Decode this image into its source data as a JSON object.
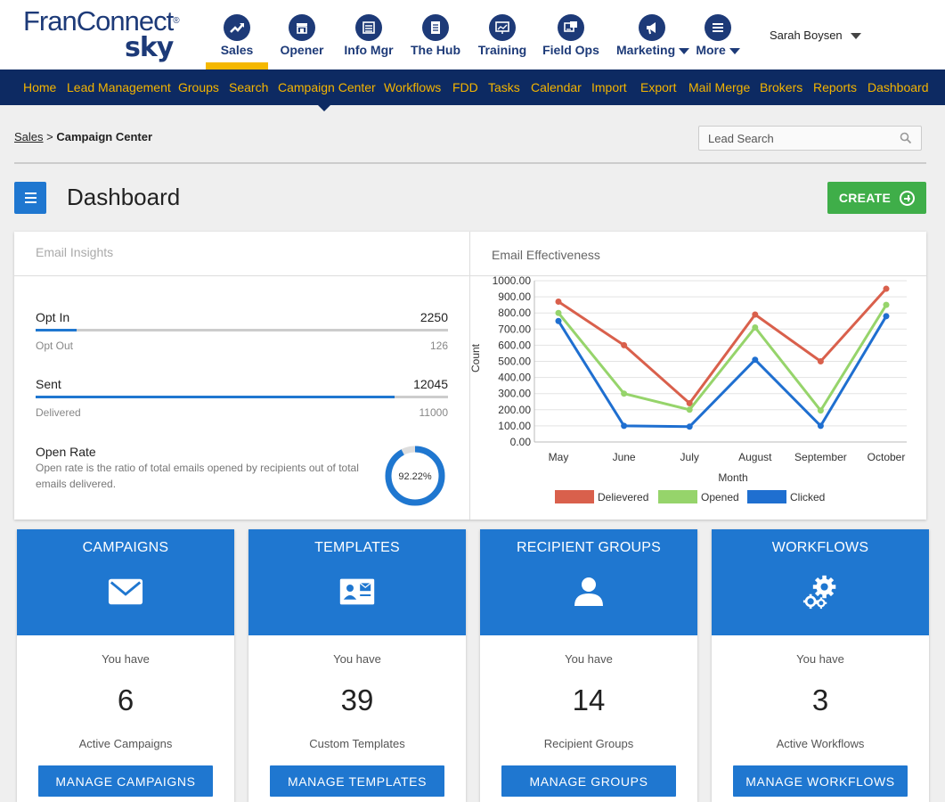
{
  "header": {
    "logo_text_main": "FranConnect",
    "logo_reg": "®",
    "logo_text_sub": "sky",
    "modules": [
      {
        "label": "Sales",
        "icon": "trending-up-icon"
      },
      {
        "label": "Opener",
        "icon": "storefront-icon"
      },
      {
        "label": "Info Mgr",
        "icon": "list-icon"
      },
      {
        "label": "The Hub",
        "icon": "document-icon"
      },
      {
        "label": "Training",
        "icon": "presentation-icon"
      },
      {
        "label": "Field Ops",
        "icon": "tasks-icon"
      },
      {
        "label": "Marketing",
        "icon": "megaphone-icon"
      },
      {
        "label": "More",
        "icon": "hamburger-icon"
      }
    ],
    "user_name": "Sarah Boysen"
  },
  "nav": {
    "items": [
      "Home",
      "Lead Management",
      "Groups",
      "Search",
      "Campaign Center",
      "Workflows",
      "FDD",
      "Tasks",
      "Calendar",
      "Import",
      "Export",
      "Mail Merge",
      "Brokers",
      "Reports",
      "Dashboard"
    ]
  },
  "breadcrumb": {
    "root": "Sales",
    "separator": ">",
    "current": "Campaign Center"
  },
  "search": {
    "placeholder": "Lead Search"
  },
  "page": {
    "title": "Dashboard",
    "create_label": "CREATE"
  },
  "insights": {
    "title": "Email Insights",
    "opt_in_label": "Opt In",
    "opt_in_value": "2250",
    "opt_out_label": "Opt Out",
    "opt_out_value": "126",
    "opt_in_fill": 0.1,
    "sent_label": "Sent",
    "sent_value": "12045",
    "delivered_label": "Delivered",
    "delivered_value": "11000",
    "sent_fill": 0.87,
    "open_rate_title": "Open Rate",
    "open_rate_desc": "Open rate is the ratio of total emails opened by recipients out of total emails delivered.",
    "open_rate_value": "92.22%",
    "open_rate_fraction": 0.9222
  },
  "chart_data": {
    "type": "line",
    "title": "Email Effectiveness",
    "xlabel": "Month",
    "ylabel": "Count",
    "categories": [
      "May",
      "June",
      "July",
      "August",
      "September",
      "October"
    ],
    "ylim": [
      0,
      1000
    ],
    "yticks": [
      "0.00",
      "100.00",
      "200.00",
      "300.00",
      "400.00",
      "500.00",
      "600.00",
      "700.00",
      "800.00",
      "900.00",
      "1000.00"
    ],
    "grid": true,
    "legend_position": "bottom",
    "series": [
      {
        "name": "Delievered",
        "color": "#d9604c",
        "values": [
          870,
          600,
          240,
          790,
          500,
          950
        ]
      },
      {
        "name": "Opened",
        "color": "#96d46b",
        "values": [
          800,
          300,
          200,
          710,
          195,
          850
        ]
      },
      {
        "name": "Clicked",
        "color": "#1f6fd0",
        "values": [
          750,
          100,
          95,
          510,
          100,
          780
        ]
      }
    ]
  },
  "cards": [
    {
      "title": "CAMPAIGNS",
      "icon": "envelope-icon",
      "you_have": "You have",
      "count": "6",
      "desc": "Active Campaigns",
      "button": "MANAGE CAMPAIGNS"
    },
    {
      "title": "TEMPLATES",
      "icon": "id-card-icon",
      "you_have": "You have",
      "count": "39",
      "desc": "Custom Templates",
      "button": "MANAGE TEMPLATES"
    },
    {
      "title": "RECIPIENT GROUPS",
      "icon": "user-icon",
      "you_have": "You have",
      "count": "14",
      "desc": "Recipient Groups",
      "button": "MANAGE GROUPS"
    },
    {
      "title": "WORKFLOWS",
      "icon": "gears-icon",
      "you_have": "You have",
      "count": "3",
      "desc": "Active Workflows",
      "button": "MANAGE WORKFLOWS"
    }
  ],
  "colors": {
    "brand_navy": "#0d2a62",
    "nav_text": "#f4b400",
    "primary_blue": "#1f77d0",
    "create_green": "#3fae49"
  }
}
